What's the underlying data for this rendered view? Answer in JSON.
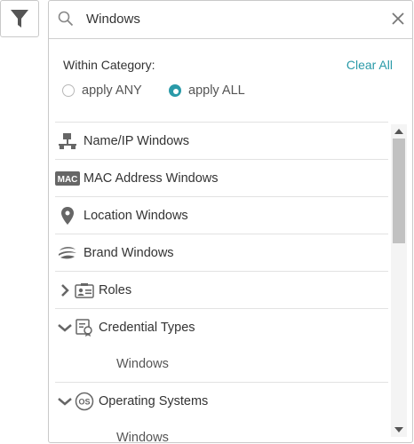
{
  "search": {
    "value": "Windows"
  },
  "filters": {
    "within_label": "Within Category:",
    "clear_all": "Clear All",
    "apply_any": "apply ANY",
    "apply_all": "apply ALL",
    "selected_mode": "apply ALL"
  },
  "categories": [
    {
      "label": "Name/IP Windows",
      "icon": "network-node-icon"
    },
    {
      "label": "MAC Address Windows",
      "icon": "mac-badge-icon",
      "badge": "MAC"
    },
    {
      "label": "Location Windows",
      "icon": "map-pin-icon"
    },
    {
      "label": "Brand Windows",
      "icon": "brand-icon"
    },
    {
      "label": "Roles",
      "icon": "roles-card-icon",
      "expanded": false
    },
    {
      "label": "Credential Types",
      "icon": "certificate-icon",
      "expanded": true,
      "children": [
        "Windows"
      ]
    },
    {
      "label": "Operating Systems",
      "icon": "os-badge-icon",
      "badge": "OS",
      "expanded": true,
      "children": [
        "Windows"
      ]
    }
  ],
  "colors": {
    "accent": "#2a9aa8",
    "icon": "#666666",
    "border": "#c9c9c9"
  }
}
